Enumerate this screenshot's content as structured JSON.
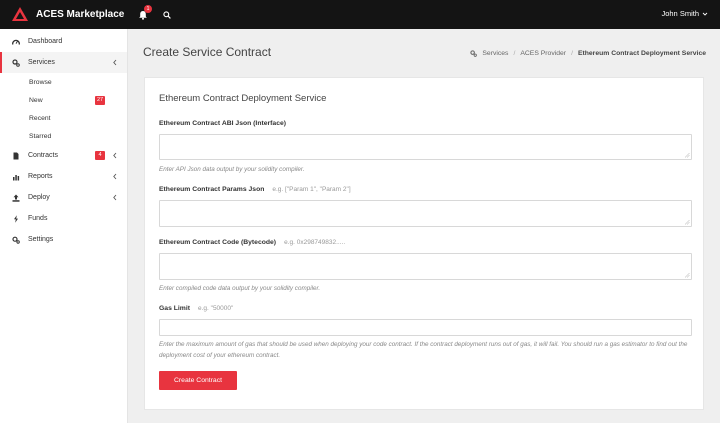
{
  "app": {
    "title": "ACES Marketplace",
    "notifications": "1"
  },
  "user": {
    "name": "John Smith"
  },
  "sidebar": {
    "items": [
      {
        "label": "Dashboard",
        "icon": "dashboard-icon"
      },
      {
        "label": "Services",
        "icon": "gears-icon",
        "active": true
      },
      {
        "label": "Contracts",
        "icon": "file-icon",
        "badge": "4"
      },
      {
        "label": "Reports",
        "icon": "bar-chart-icon"
      },
      {
        "label": "Deploy",
        "icon": "upload-icon"
      },
      {
        "label": "Funds",
        "icon": "bolt-icon"
      },
      {
        "label": "Settings",
        "icon": "settings-icon"
      }
    ],
    "services_sub": [
      {
        "label": "Browse"
      },
      {
        "label": "New",
        "badge": "27"
      },
      {
        "label": "Recent"
      },
      {
        "label": "Starred"
      }
    ]
  },
  "page": {
    "title": "Create Service Contract",
    "breadcrumb": [
      "Services",
      "ACES Provider",
      "Ethereum Contract Deployment Service"
    ]
  },
  "form": {
    "title": "Ethereum Contract Deployment Service",
    "abi": {
      "label": "Ethereum Contract ABI Json (Interface)",
      "help": "Enter API Json data output by your solidity compiler.",
      "value": ""
    },
    "params": {
      "label": "Ethereum Contract Params Json",
      "example": "e.g. [\"Param 1\", \"Param 2\"]",
      "value": ""
    },
    "code": {
      "label": "Ethereum Contract Code (Bytecode)",
      "example": "e.g. 0x298749832.....",
      "help": "Enter compiled code data output by your solidity compiler.",
      "value": ""
    },
    "gas": {
      "label": "Gas Limit",
      "example": "e.g. \"50000\"",
      "help": "Enter the maximum amount of gas that should be used when deploying your code contract. If the contract deployment runs out of gas, it will fail. You should run a gas estimator to find out the deployment cost of your ethereum contract.",
      "value": ""
    },
    "submit_label": "Create Contract"
  },
  "colors": {
    "accent": "#e8343f",
    "topbar": "#141414"
  }
}
